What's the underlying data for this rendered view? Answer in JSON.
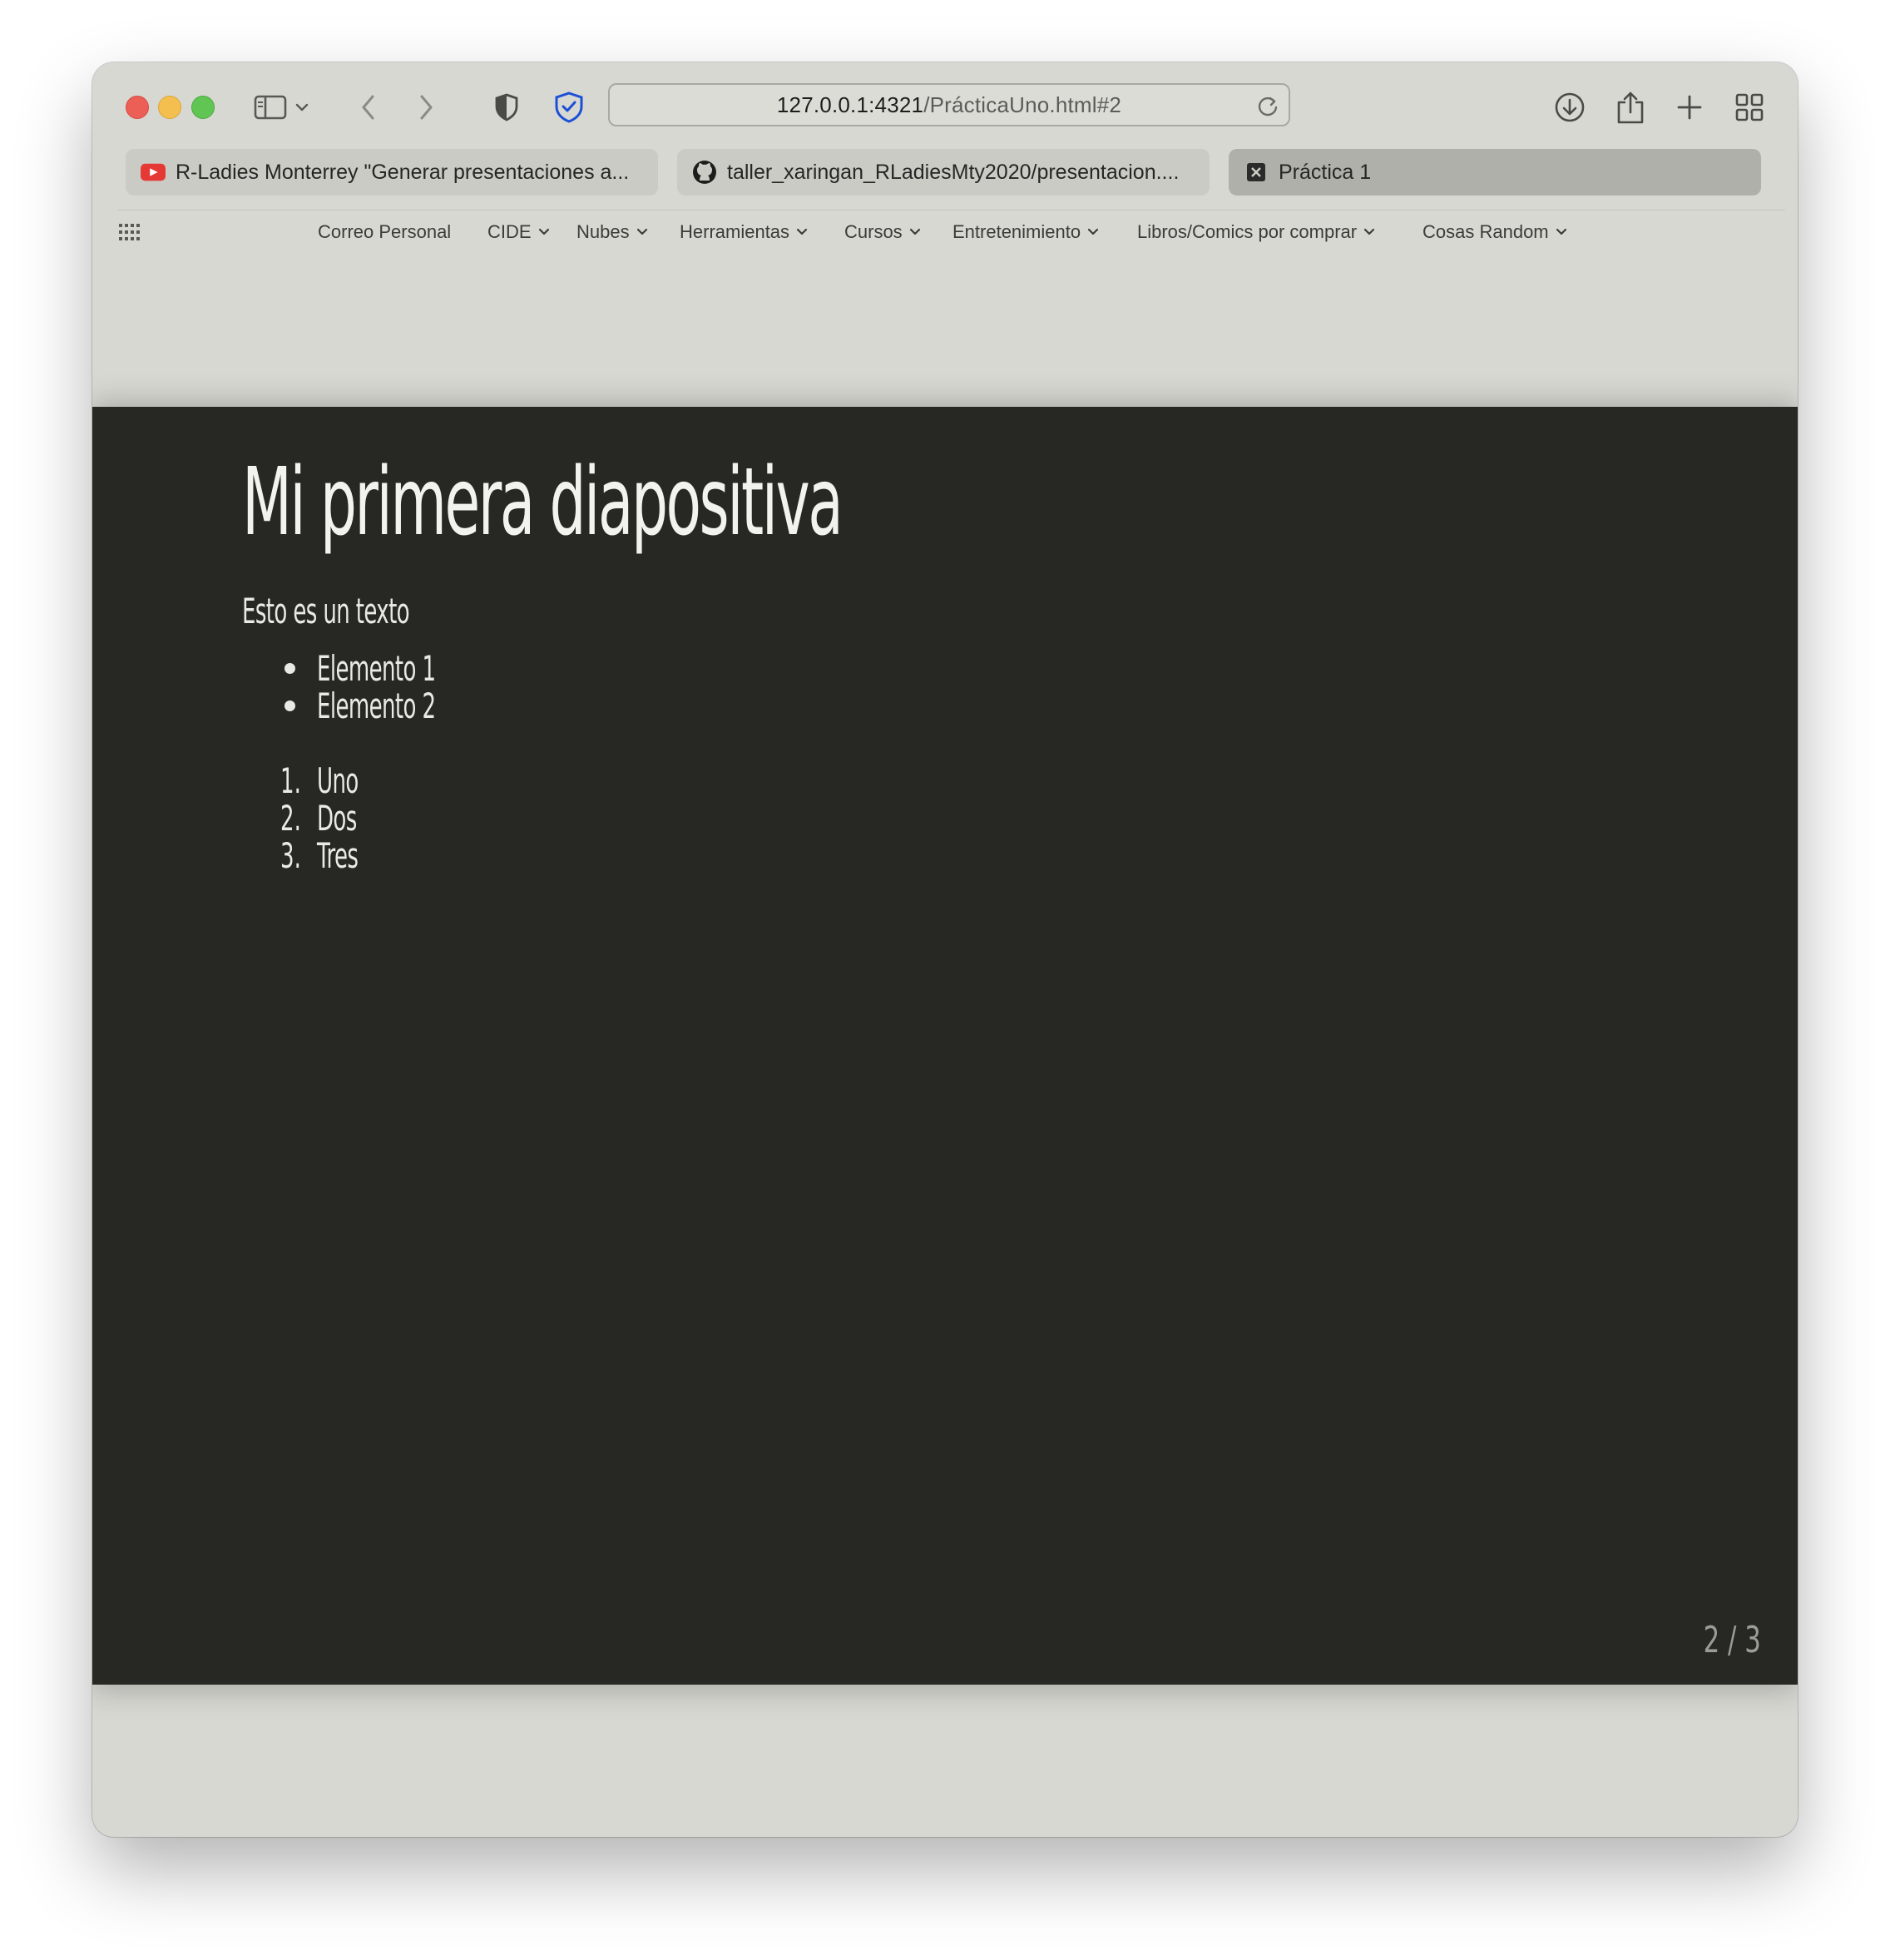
{
  "browser": {
    "address_bar": {
      "host": "127.0.0.1:4321",
      "path": "/PrácticaUno.html#2"
    },
    "tabs": [
      {
        "title": "R-Ladies Monterrey \"Generar presentaciones a...",
        "favicon": "youtube-icon",
        "active": false
      },
      {
        "title": "taller_xaringan_RLadiesMty2020/presentacion....",
        "favicon": "github-icon",
        "active": false
      },
      {
        "title": "Práctica 1",
        "favicon": "close-square-icon",
        "active": true
      }
    ],
    "favorites": [
      {
        "label": "Correo Personal",
        "has_menu": false
      },
      {
        "label": "CIDE",
        "has_menu": true
      },
      {
        "label": "Nubes",
        "has_menu": true
      },
      {
        "label": "Herramientas",
        "has_menu": true
      },
      {
        "label": "Cursos",
        "has_menu": true
      },
      {
        "label": "Entretenimiento",
        "has_menu": true
      },
      {
        "label": "Libros/Comics por comprar",
        "has_menu": true
      },
      {
        "label": "Cosas Random",
        "has_menu": true
      }
    ],
    "toolbar_icons": [
      "sidebar-icon",
      "chevron-down-icon",
      "back-icon",
      "forward-icon",
      "privacy-shield-icon",
      "adblock-shield-icon",
      "reload-icon",
      "download-icon",
      "share-icon",
      "new-tab-icon",
      "tab-overview-icon"
    ]
  },
  "slide": {
    "title": "Mi primera diapositiva",
    "text": "Esto es un texto",
    "bullets": [
      "Elemento 1",
      "Elemento 2"
    ],
    "numbered": [
      {
        "num": "1.",
        "label": "Uno"
      },
      {
        "num": "2.",
        "label": "Dos"
      },
      {
        "num": "3.",
        "label": "Tres"
      }
    ],
    "slide_number": "2 / 3"
  },
  "colors": {
    "slide_background": "#272723",
    "slide_text": "#e9e9e6",
    "chrome_background": "#d8d8d3",
    "active_tab": "#b0b0ab"
  }
}
